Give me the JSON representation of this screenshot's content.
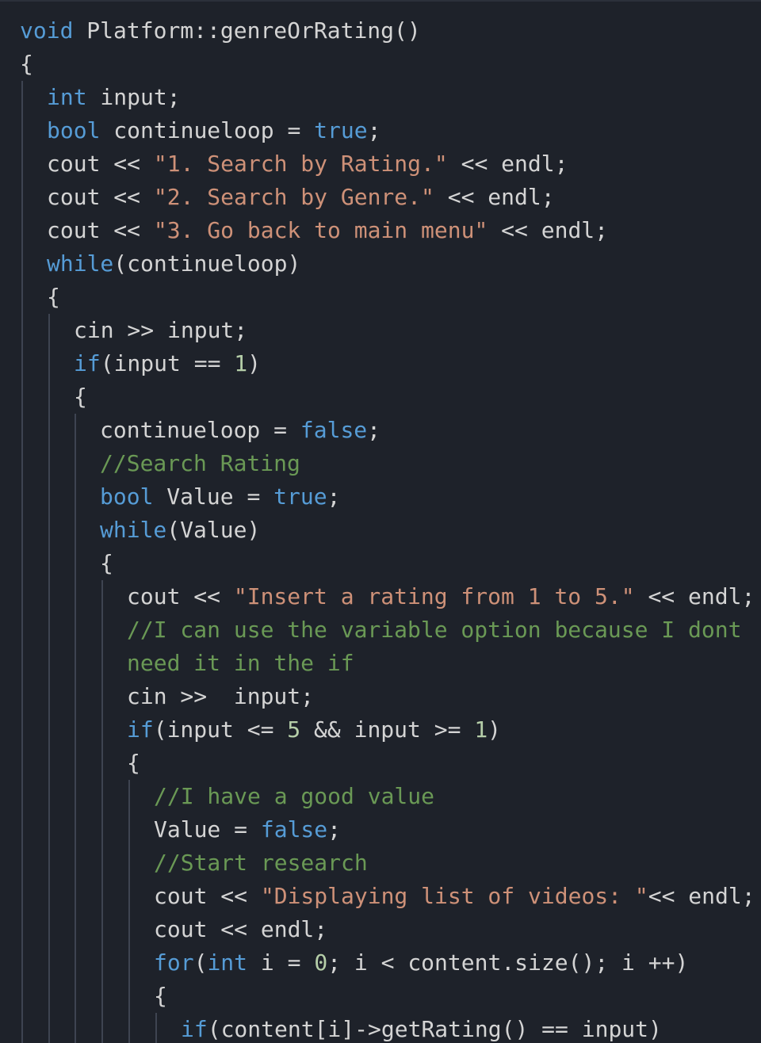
{
  "editor": {
    "language": "cpp",
    "colors": {
      "background": "#1e222a",
      "keyword": "#569cd6",
      "string": "#ce9178",
      "number": "#b5cea8",
      "comment": "#6a9955",
      "plain": "#d4d4d4",
      "indent_guide": "#3e4451"
    },
    "lines": [
      {
        "indent": 0,
        "tokens": [
          {
            "t": "kw",
            "v": "void"
          },
          {
            "t": "pl",
            "v": " Platform::genreOrRating()"
          }
        ]
      },
      {
        "indent": 0,
        "tokens": [
          {
            "t": "pl",
            "v": "{"
          }
        ]
      },
      {
        "indent": 1,
        "tokens": [
          {
            "t": "kw",
            "v": "int"
          },
          {
            "t": "pl",
            "v": " input;"
          }
        ]
      },
      {
        "indent": 1,
        "tokens": [
          {
            "t": "kw",
            "v": "bool"
          },
          {
            "t": "pl",
            "v": " continueloop = "
          },
          {
            "t": "kw",
            "v": "true"
          },
          {
            "t": "pl",
            "v": ";"
          }
        ]
      },
      {
        "indent": 1,
        "tokens": [
          {
            "t": "pl",
            "v": "cout << "
          },
          {
            "t": "str",
            "v": "\"1. Search by Rating.\""
          },
          {
            "t": "pl",
            "v": " << endl;"
          }
        ]
      },
      {
        "indent": 1,
        "tokens": [
          {
            "t": "pl",
            "v": "cout << "
          },
          {
            "t": "str",
            "v": "\"2. Search by Genre.\""
          },
          {
            "t": "pl",
            "v": " << endl;"
          }
        ]
      },
      {
        "indent": 1,
        "tokens": [
          {
            "t": "pl",
            "v": "cout << "
          },
          {
            "t": "str",
            "v": "\"3. Go back to main menu\""
          },
          {
            "t": "pl",
            "v": " << endl;"
          }
        ]
      },
      {
        "indent": 1,
        "tokens": [
          {
            "t": "kw",
            "v": "while"
          },
          {
            "t": "pl",
            "v": "(continueloop)"
          }
        ]
      },
      {
        "indent": 1,
        "tokens": [
          {
            "t": "pl",
            "v": "{"
          }
        ]
      },
      {
        "indent": 2,
        "tokens": [
          {
            "t": "pl",
            "v": "cin >> input;"
          }
        ]
      },
      {
        "indent": 2,
        "tokens": [
          {
            "t": "kw",
            "v": "if"
          },
          {
            "t": "pl",
            "v": "(input == "
          },
          {
            "t": "num",
            "v": "1"
          },
          {
            "t": "pl",
            "v": ")"
          }
        ]
      },
      {
        "indent": 2,
        "tokens": [
          {
            "t": "pl",
            "v": "{"
          }
        ]
      },
      {
        "indent": 3,
        "tokens": [
          {
            "t": "pl",
            "v": "continueloop = "
          },
          {
            "t": "kw",
            "v": "false"
          },
          {
            "t": "pl",
            "v": ";"
          }
        ]
      },
      {
        "indent": 3,
        "tokens": [
          {
            "t": "com",
            "v": "//Search Rating"
          }
        ]
      },
      {
        "indent": 3,
        "tokens": [
          {
            "t": "kw",
            "v": "bool"
          },
          {
            "t": "pl",
            "v": " Value = "
          },
          {
            "t": "kw",
            "v": "true"
          },
          {
            "t": "pl",
            "v": ";"
          }
        ]
      },
      {
        "indent": 3,
        "tokens": [
          {
            "t": "kw",
            "v": "while"
          },
          {
            "t": "pl",
            "v": "(Value)"
          }
        ]
      },
      {
        "indent": 3,
        "tokens": [
          {
            "t": "pl",
            "v": "{"
          }
        ]
      },
      {
        "indent": 4,
        "tokens": [
          {
            "t": "pl",
            "v": "cout << "
          },
          {
            "t": "str",
            "v": "\"Insert a rating from 1 to 5.\""
          },
          {
            "t": "pl",
            "v": " << endl;"
          }
        ]
      },
      {
        "indent": 4,
        "tokens": [
          {
            "t": "com",
            "v": "//I can use the variable option because I dont"
          }
        ]
      },
      {
        "indent": 4,
        "tokens": [
          {
            "t": "com",
            "v": "need it in the if"
          }
        ]
      },
      {
        "indent": 4,
        "tokens": [
          {
            "t": "pl",
            "v": "cin >>  input;"
          }
        ]
      },
      {
        "indent": 4,
        "tokens": [
          {
            "t": "kw",
            "v": "if"
          },
          {
            "t": "pl",
            "v": "(input <= "
          },
          {
            "t": "num",
            "v": "5"
          },
          {
            "t": "pl",
            "v": " && input >= "
          },
          {
            "t": "num",
            "v": "1"
          },
          {
            "t": "pl",
            "v": ")"
          }
        ]
      },
      {
        "indent": 4,
        "tokens": [
          {
            "t": "pl",
            "v": "{"
          }
        ]
      },
      {
        "indent": 5,
        "tokens": [
          {
            "t": "com",
            "v": "//I have a good value"
          }
        ]
      },
      {
        "indent": 5,
        "tokens": [
          {
            "t": "pl",
            "v": "Value = "
          },
          {
            "t": "kw",
            "v": "false"
          },
          {
            "t": "pl",
            "v": ";"
          }
        ]
      },
      {
        "indent": 5,
        "tokens": [
          {
            "t": "com",
            "v": "//Start research"
          }
        ]
      },
      {
        "indent": 5,
        "tokens": [
          {
            "t": "pl",
            "v": "cout << "
          },
          {
            "t": "str",
            "v": "\"Displaying list of videos: \""
          },
          {
            "t": "pl",
            "v": "<< endl;"
          }
        ]
      },
      {
        "indent": 5,
        "tokens": [
          {
            "t": "pl",
            "v": "cout << endl;"
          }
        ]
      },
      {
        "indent": 5,
        "tokens": [
          {
            "t": "kw",
            "v": "for"
          },
          {
            "t": "pl",
            "v": "("
          },
          {
            "t": "kw",
            "v": "int"
          },
          {
            "t": "pl",
            "v": " i = "
          },
          {
            "t": "num",
            "v": "0"
          },
          {
            "t": "pl",
            "v": "; i < content.size(); i ++)"
          }
        ]
      },
      {
        "indent": 5,
        "tokens": [
          {
            "t": "pl",
            "v": "{"
          }
        ]
      },
      {
        "indent": 6,
        "tokens": [
          {
            "t": "kw",
            "v": "if"
          },
          {
            "t": "pl",
            "v": "(content[i]->getRating() == input)"
          }
        ]
      }
    ]
  }
}
